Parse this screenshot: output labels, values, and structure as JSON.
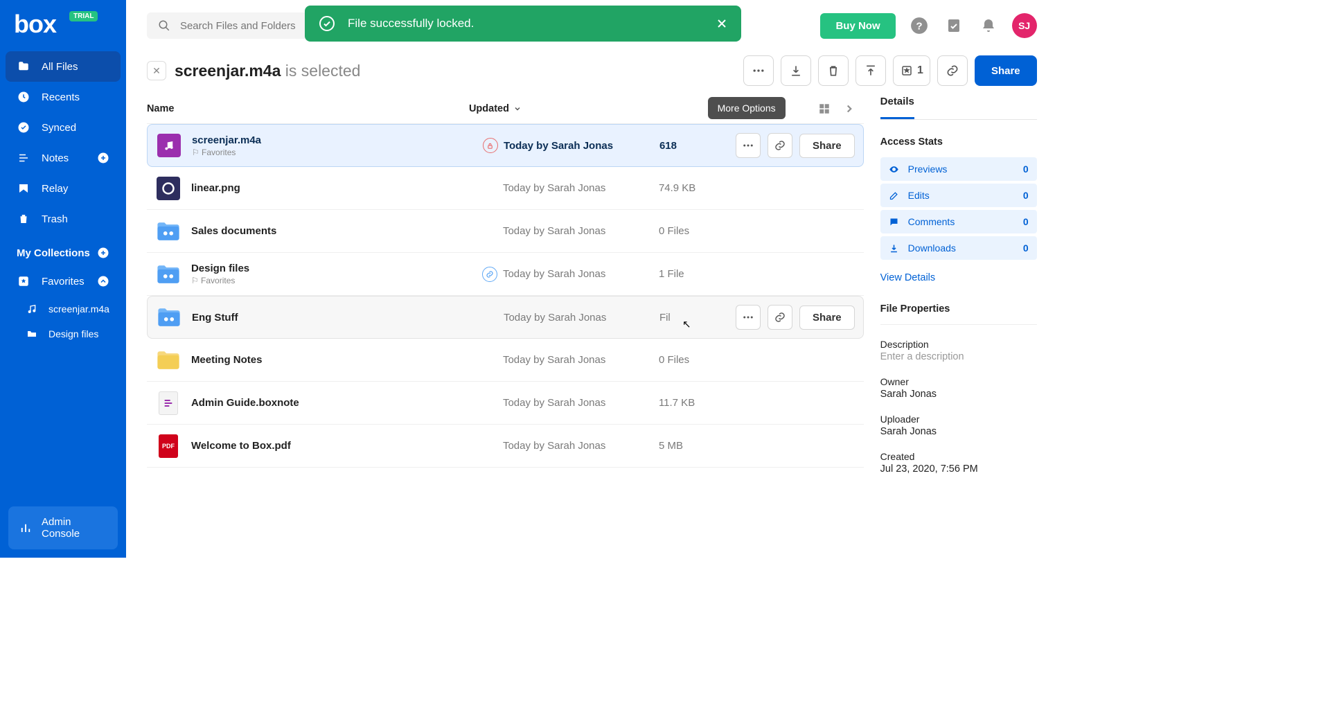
{
  "logo": "box",
  "trial_badge": "TRIAL",
  "sidebar": {
    "items": [
      {
        "label": "All Files"
      },
      {
        "label": "Recents"
      },
      {
        "label": "Synced"
      },
      {
        "label": "Notes"
      },
      {
        "label": "Relay"
      },
      {
        "label": "Trash"
      }
    ],
    "collections_header": "My Collections",
    "favorites_label": "Favorites",
    "fav_items": [
      {
        "label": "screenjar.m4a"
      },
      {
        "label": "Design files"
      }
    ],
    "admin_console": "Admin Console"
  },
  "search_placeholder": "Search Files and Folders",
  "buy_now": "Buy Now",
  "avatar_initials": "SJ",
  "toast": {
    "message": "File successfully locked."
  },
  "selection": {
    "filename": "screenjar.m4a",
    "suffix": " is selected"
  },
  "toolbar": {
    "collection_count": "1",
    "share": "Share"
  },
  "tooltip_more": "More Options",
  "columns": {
    "name": "Name",
    "updated": "Updated"
  },
  "rows": [
    {
      "name": "screenjar.m4a",
      "fav": "Favorites",
      "updated": "Today by Sarah Jonas",
      "size": "618",
      "locked": true,
      "share": "Share",
      "selected": true,
      "type": "audio"
    },
    {
      "name": "linear.png",
      "updated": "Today by Sarah Jonas",
      "size": "74.9 KB",
      "type": "image"
    },
    {
      "name": "Sales documents",
      "updated": "Today by Sarah Jonas",
      "size": "0 Files",
      "type": "shared-folder"
    },
    {
      "name": "Design files",
      "fav": "Favorites",
      "updated": "Today by Sarah Jonas",
      "size": "1 File",
      "type": "shared-folder",
      "linked": true
    },
    {
      "name": "Eng Stuff",
      "updated": "Today by Sarah Jonas",
      "size": "  Fil",
      "type": "shared-folder",
      "hover": true,
      "share": "Share"
    },
    {
      "name": "Meeting Notes",
      "updated": "Today by Sarah Jonas",
      "size": "0 Files",
      "type": "folder"
    },
    {
      "name": "Admin Guide.boxnote",
      "updated": "Today by Sarah Jonas",
      "size": "11.7 KB",
      "type": "boxnote"
    },
    {
      "name": "Welcome to Box.pdf",
      "updated": "Today by Sarah Jonas",
      "size": "5 MB",
      "type": "pdf"
    }
  ],
  "details": {
    "tab": "Details",
    "access_stats_title": "Access Stats",
    "stats": [
      {
        "label": "Previews",
        "count": "0"
      },
      {
        "label": "Edits",
        "count": "0"
      },
      {
        "label": "Comments",
        "count": "0"
      },
      {
        "label": "Downloads",
        "count": "0"
      }
    ],
    "view_details": "View Details",
    "file_props_title": "File Properties",
    "description_label": "Description",
    "description_placeholder": "Enter a description",
    "owner_label": "Owner",
    "owner_value": "Sarah Jonas",
    "uploader_label": "Uploader",
    "uploader_value": "Sarah Jonas",
    "created_label": "Created",
    "created_value": "Jul 23, 2020, 7:56 PM"
  }
}
